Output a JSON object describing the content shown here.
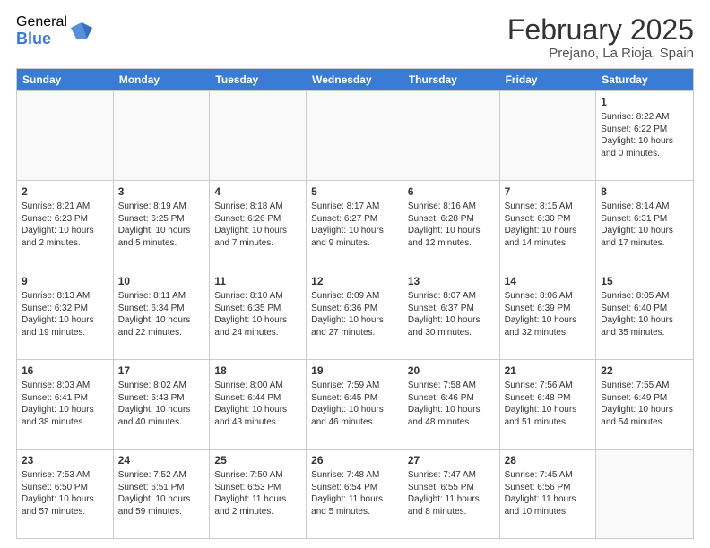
{
  "logo": {
    "general": "General",
    "blue": "Blue"
  },
  "header": {
    "month": "February 2025",
    "location": "Prejano, La Rioja, Spain"
  },
  "weekdays": [
    "Sunday",
    "Monday",
    "Tuesday",
    "Wednesday",
    "Thursday",
    "Friday",
    "Saturday"
  ],
  "weeks": [
    [
      {
        "day": "",
        "info": ""
      },
      {
        "day": "",
        "info": ""
      },
      {
        "day": "",
        "info": ""
      },
      {
        "day": "",
        "info": ""
      },
      {
        "day": "",
        "info": ""
      },
      {
        "day": "",
        "info": ""
      },
      {
        "day": "1",
        "info": "Sunrise: 8:22 AM\nSunset: 6:22 PM\nDaylight: 10 hours\nand 0 minutes."
      }
    ],
    [
      {
        "day": "2",
        "info": "Sunrise: 8:21 AM\nSunset: 6:23 PM\nDaylight: 10 hours\nand 2 minutes."
      },
      {
        "day": "3",
        "info": "Sunrise: 8:19 AM\nSunset: 6:25 PM\nDaylight: 10 hours\nand 5 minutes."
      },
      {
        "day": "4",
        "info": "Sunrise: 8:18 AM\nSunset: 6:26 PM\nDaylight: 10 hours\nand 7 minutes."
      },
      {
        "day": "5",
        "info": "Sunrise: 8:17 AM\nSunset: 6:27 PM\nDaylight: 10 hours\nand 9 minutes."
      },
      {
        "day": "6",
        "info": "Sunrise: 8:16 AM\nSunset: 6:28 PM\nDaylight: 10 hours\nand 12 minutes."
      },
      {
        "day": "7",
        "info": "Sunrise: 8:15 AM\nSunset: 6:30 PM\nDaylight: 10 hours\nand 14 minutes."
      },
      {
        "day": "8",
        "info": "Sunrise: 8:14 AM\nSunset: 6:31 PM\nDaylight: 10 hours\nand 17 minutes."
      }
    ],
    [
      {
        "day": "9",
        "info": "Sunrise: 8:13 AM\nSunset: 6:32 PM\nDaylight: 10 hours\nand 19 minutes."
      },
      {
        "day": "10",
        "info": "Sunrise: 8:11 AM\nSunset: 6:34 PM\nDaylight: 10 hours\nand 22 minutes."
      },
      {
        "day": "11",
        "info": "Sunrise: 8:10 AM\nSunset: 6:35 PM\nDaylight: 10 hours\nand 24 minutes."
      },
      {
        "day": "12",
        "info": "Sunrise: 8:09 AM\nSunset: 6:36 PM\nDaylight: 10 hours\nand 27 minutes."
      },
      {
        "day": "13",
        "info": "Sunrise: 8:07 AM\nSunset: 6:37 PM\nDaylight: 10 hours\nand 30 minutes."
      },
      {
        "day": "14",
        "info": "Sunrise: 8:06 AM\nSunset: 6:39 PM\nDaylight: 10 hours\nand 32 minutes."
      },
      {
        "day": "15",
        "info": "Sunrise: 8:05 AM\nSunset: 6:40 PM\nDaylight: 10 hours\nand 35 minutes."
      }
    ],
    [
      {
        "day": "16",
        "info": "Sunrise: 8:03 AM\nSunset: 6:41 PM\nDaylight: 10 hours\nand 38 minutes."
      },
      {
        "day": "17",
        "info": "Sunrise: 8:02 AM\nSunset: 6:43 PM\nDaylight: 10 hours\nand 40 minutes."
      },
      {
        "day": "18",
        "info": "Sunrise: 8:00 AM\nSunset: 6:44 PM\nDaylight: 10 hours\nand 43 minutes."
      },
      {
        "day": "19",
        "info": "Sunrise: 7:59 AM\nSunset: 6:45 PM\nDaylight: 10 hours\nand 46 minutes."
      },
      {
        "day": "20",
        "info": "Sunrise: 7:58 AM\nSunset: 6:46 PM\nDaylight: 10 hours\nand 48 minutes."
      },
      {
        "day": "21",
        "info": "Sunrise: 7:56 AM\nSunset: 6:48 PM\nDaylight: 10 hours\nand 51 minutes."
      },
      {
        "day": "22",
        "info": "Sunrise: 7:55 AM\nSunset: 6:49 PM\nDaylight: 10 hours\nand 54 minutes."
      }
    ],
    [
      {
        "day": "23",
        "info": "Sunrise: 7:53 AM\nSunset: 6:50 PM\nDaylight: 10 hours\nand 57 minutes."
      },
      {
        "day": "24",
        "info": "Sunrise: 7:52 AM\nSunset: 6:51 PM\nDaylight: 10 hours\nand 59 minutes."
      },
      {
        "day": "25",
        "info": "Sunrise: 7:50 AM\nSunset: 6:53 PM\nDaylight: 11 hours\nand 2 minutes."
      },
      {
        "day": "26",
        "info": "Sunrise: 7:48 AM\nSunset: 6:54 PM\nDaylight: 11 hours\nand 5 minutes."
      },
      {
        "day": "27",
        "info": "Sunrise: 7:47 AM\nSunset: 6:55 PM\nDaylight: 11 hours\nand 8 minutes."
      },
      {
        "day": "28",
        "info": "Sunrise: 7:45 AM\nSunset: 6:56 PM\nDaylight: 11 hours\nand 10 minutes."
      },
      {
        "day": "",
        "info": ""
      }
    ]
  ]
}
